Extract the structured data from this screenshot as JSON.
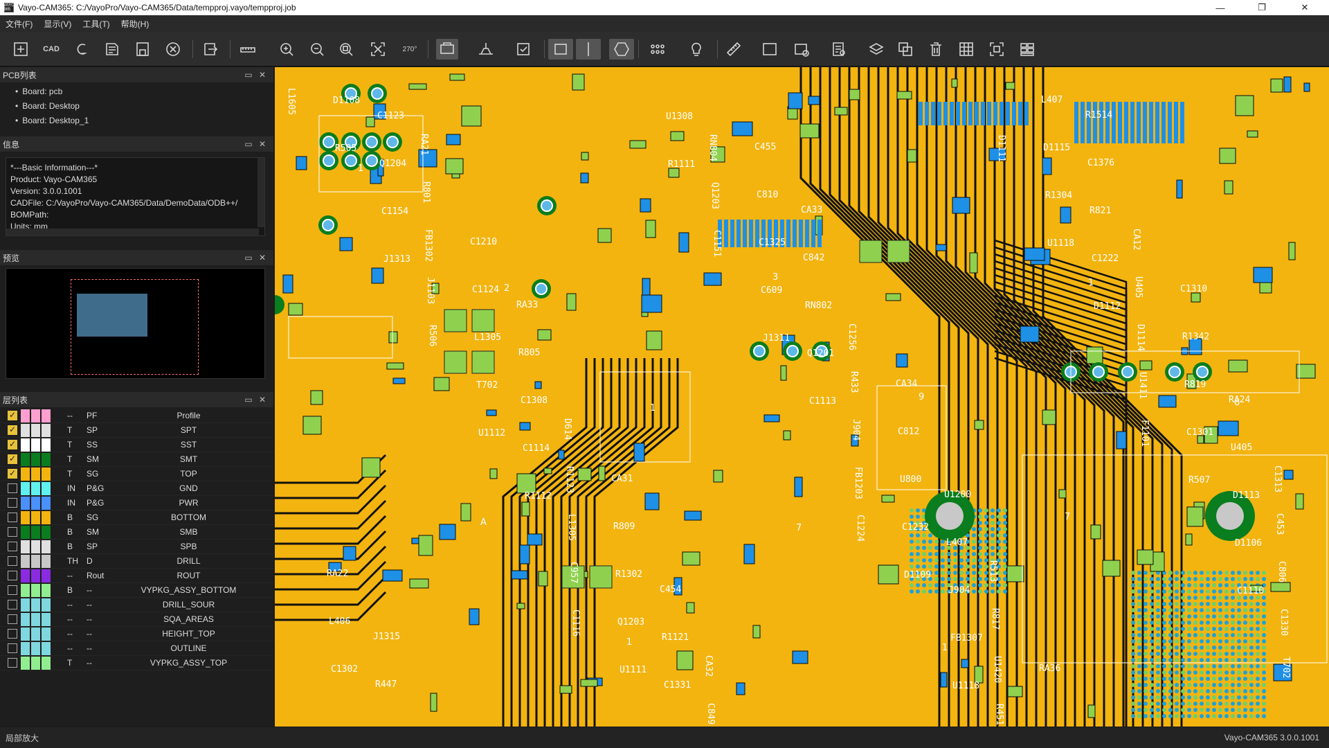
{
  "window": {
    "title": "Vayo-CAM365: C:/VayoPro/Vayo-CAM365/Data/tempproj.vayo/tempproj.job",
    "icon_text": "VAYO 365"
  },
  "menu": [
    "文件(F)",
    "显示(V)",
    "工具(T)",
    "帮助(H)"
  ],
  "toolbar": {
    "cad_label": "CAD",
    "rotate_label": "270°",
    "icons": [
      "new-icon",
      "cad-icon",
      "gerber-icon",
      "open-icon",
      "save-icon",
      "close-circle-icon",
      "export-icon",
      "measure-unit-icon",
      "zoom-in-icon",
      "zoom-out-icon",
      "zoom-fit-icon",
      "fit-screen-icon",
      "rotate-icon",
      "view-board-icon",
      "mount-icon",
      "check-icon",
      "rect-select-icon",
      "line-select-icon",
      "polygon-select-icon",
      "pads-icon",
      "bulb-icon",
      "ruler-icon",
      "layer-box-icon",
      "component-icon",
      "report-icon",
      "layers-icon",
      "copy-icon",
      "delete-icon",
      "grid-icon",
      "center-icon",
      "panel-icon"
    ]
  },
  "pcb_panel": {
    "title": "PCB列表",
    "boards": [
      "Board: pcb",
      "Board: Desktop",
      "Board: Desktop_1"
    ]
  },
  "info_panel": {
    "title": "信息",
    "lines": [
      "*---Basic Information---*",
      "Product: Vayo-CAM365",
      "Version: 3.0.0.1001",
      "CADFile: C:/VayoPro/Vayo-CAM365/Data/DemoData/ODB++/",
      "BOMPath:",
      "Units: mm"
    ]
  },
  "preview_panel": {
    "title": "预览"
  },
  "layer_panel": {
    "title": "层列表",
    "layers": [
      {
        "checked": true,
        "c1": "#ff9fd0",
        "c2": "#ff9fd0",
        "c3": "#ff9fd0",
        "side": "--",
        "type": "PF",
        "name": "Profile"
      },
      {
        "checked": true,
        "c1": "#e0e0e0",
        "c2": "#e0e0e0",
        "c3": "#e0e0e0",
        "side": "T",
        "type": "SP",
        "name": "SPT"
      },
      {
        "checked": true,
        "c1": "#ffffff",
        "c2": "#ffffff",
        "c3": "#ffffff",
        "side": "T",
        "type": "SS",
        "name": "SST"
      },
      {
        "checked": true,
        "c1": "#0a7d1e",
        "c2": "#0a7d1e",
        "c3": "#0a7d1e",
        "side": "T",
        "type": "SM",
        "name": "SMT"
      },
      {
        "checked": true,
        "c1": "#f3b410",
        "c2": "#f3b410",
        "c3": "#f3b410",
        "side": "T",
        "type": "SG",
        "name": "TOP"
      },
      {
        "checked": false,
        "c1": "#60f0f0",
        "c2": "#60f0f0",
        "c3": "#60f0f0",
        "side": "IN",
        "type": "P&G",
        "name": "GND"
      },
      {
        "checked": false,
        "c1": "#4a90ff",
        "c2": "#4a90ff",
        "c3": "#4a90ff",
        "side": "IN",
        "type": "P&G",
        "name": "PWR"
      },
      {
        "checked": false,
        "c1": "#f3b410",
        "c2": "#f3b410",
        "c3": "#f3b410",
        "side": "B",
        "type": "SG",
        "name": "BOTTOM"
      },
      {
        "checked": false,
        "c1": "#0a7d1e",
        "c2": "#0a7d1e",
        "c3": "#0a7d1e",
        "side": "B",
        "type": "SM",
        "name": "SMB"
      },
      {
        "checked": false,
        "c1": "#e0e0e0",
        "c2": "#e0e0e0",
        "c3": "#e0e0e0",
        "side": "B",
        "type": "SP",
        "name": "SPB"
      },
      {
        "checked": false,
        "c1": "#c8c8c8",
        "c2": "#c8c8c8",
        "c3": "#c8c8c8",
        "side": "TH",
        "type": "D",
        "name": "DRILL"
      },
      {
        "checked": false,
        "c1": "#8a2be2",
        "c2": "#8a2be2",
        "c3": "#8a2be2",
        "side": "--",
        "type": "Rout",
        "name": "ROUT"
      },
      {
        "checked": false,
        "c1": "#90ee90",
        "c2": "#90ee90",
        "c3": "#90ee90",
        "side": "B",
        "type": "--",
        "name": "VYPKG_ASSY_BOTTOM"
      },
      {
        "checked": false,
        "c1": "#7fd8e0",
        "c2": "#7fd8e0",
        "c3": "#7fd8e0",
        "side": "--",
        "type": "--",
        "name": "DRILL_SOUR"
      },
      {
        "checked": false,
        "c1": "#7fd8e0",
        "c2": "#7fd8e0",
        "c3": "#7fd8e0",
        "side": "--",
        "type": "--",
        "name": "SQA_AREAS"
      },
      {
        "checked": false,
        "c1": "#7fd8e0",
        "c2": "#7fd8e0",
        "c3": "#7fd8e0",
        "side": "--",
        "type": "--",
        "name": "HEIGHT_TOP"
      },
      {
        "checked": false,
        "c1": "#7fd8e0",
        "c2": "#7fd8e0",
        "c3": "#7fd8e0",
        "side": "--",
        "type": "--",
        "name": "OUTLINE"
      },
      {
        "checked": false,
        "c1": "#90ee90",
        "c2": "#90ee90",
        "c3": "#90ee90",
        "side": "T",
        "type": "--",
        "name": "VYPKG_ASSY_TOP"
      }
    ]
  },
  "canvas": {
    "labels": [
      "L1605",
      "J1313",
      "U1112",
      "C1116",
      "R1111",
      "J1311",
      "C1224",
      "U1118",
      "U1118",
      "F1101",
      "C1110",
      "R505",
      "R506",
      "R1112",
      "U1111",
      "C1151",
      "C1113",
      "D1109",
      "D1111",
      "D1112",
      "R507",
      "T702",
      "C1154",
      "T702",
      "C957",
      "U1308",
      "C609",
      "FB1203",
      "FB1307",
      "R1304",
      "U1411",
      "D1106",
      "D1108",
      "J1103",
      "C1114",
      "Q1203",
      "Q1203",
      "Q1201",
      "C1232",
      "R451",
      "C1222",
      "C1301",
      "C1330",
      "Q1204",
      "L1305",
      "L1305",
      "C1331",
      "C1325",
      "J904",
      "J904",
      "D1115",
      "D1114",
      "D1113",
      "C1302",
      "FB1302",
      "C1308",
      "R1302",
      "RN804",
      "RN802",
      "U800",
      "U1420",
      "R821",
      "R819",
      "C806",
      "C1123",
      "C1124",
      "R1123",
      "R1121",
      "C810",
      "R433",
      "L407",
      "L407",
      "U405",
      "U405",
      "L406",
      "R801",
      "R805",
      "R809",
      "C849",
      "C842",
      "C812",
      "R817",
      "C1376",
      "R1342",
      "C453",
      "R447",
      "C1210",
      "D614",
      "C454",
      "C455",
      "C1256",
      "U1200",
      "RA36",
      "CA12",
      "RA24",
      "RA22",
      "RA21",
      "RA33",
      "CA31",
      "CA32",
      "CA33",
      "CA34",
      "R513",
      "R1514",
      "C1310",
      "C1313",
      "J1315"
    ],
    "pin_labels": [
      "1",
      "2",
      "1",
      "7",
      "1",
      "1",
      "8",
      "A",
      "1",
      "3",
      "9",
      "7"
    ],
    "colors": {
      "board": "#f3b410",
      "mask": "#0a7d1e",
      "pad_green": "#8fd14f",
      "pad_blue": "#1e90e6",
      "trace": "#111111",
      "silk": "#ffffff"
    }
  },
  "status": {
    "left": "局部放大",
    "right": "Vayo-CAM365  3.0.0.1001"
  }
}
